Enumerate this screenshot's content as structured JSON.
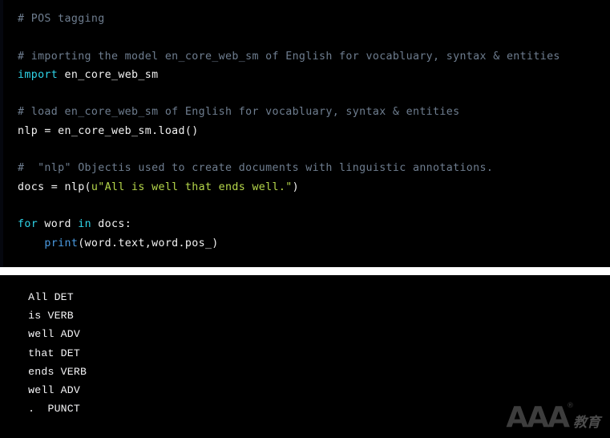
{
  "theme": {
    "editor_background": "#000000",
    "console_background": "#000000",
    "page_background": "#ffffff",
    "comment_color": "#6e7d8f",
    "keyword_color": "#2fd4e8",
    "plain_color": "#f2f2f2",
    "string_color": "#b5d64a",
    "function_color": "#4a9ae0",
    "console_text_color": "#f4f4f6",
    "watermark_color": "#707070"
  },
  "editor": {
    "name": "python-code-editor",
    "lines": [
      {
        "type": "comment",
        "text": "# POS tagging"
      },
      {
        "type": "blank",
        "text": ""
      },
      {
        "type": "comment",
        "text": "# importing the model en_core_web_sm of English for vocabluary, syntax & entities"
      },
      {
        "type": "code",
        "segments": [
          {
            "style": "kw",
            "text": "import"
          },
          {
            "style": "plain",
            "text": " en_core_web_sm"
          }
        ]
      },
      {
        "type": "blank",
        "text": ""
      },
      {
        "type": "comment",
        "text": "# load en_core_web_sm of English for vocabluary, syntax & entities"
      },
      {
        "type": "code",
        "segments": [
          {
            "style": "plain",
            "text": "nlp = en_core_web_sm.load()"
          }
        ]
      },
      {
        "type": "blank",
        "text": ""
      },
      {
        "type": "comment",
        "text": "#  \"nlp\" Objectis used to create documents with linguistic annotations."
      },
      {
        "type": "code",
        "segments": [
          {
            "style": "plain",
            "text": "docs = nlp("
          },
          {
            "style": "str",
            "text": "u\"All is well that ends well.\""
          },
          {
            "style": "plain",
            "text": ")"
          }
        ]
      },
      {
        "type": "blank",
        "text": ""
      },
      {
        "type": "code",
        "segments": [
          {
            "style": "kw",
            "text": "for"
          },
          {
            "style": "plain",
            "text": " word "
          },
          {
            "style": "kw",
            "text": "in"
          },
          {
            "style": "plain",
            "text": " docs:"
          }
        ]
      },
      {
        "type": "code",
        "segments": [
          {
            "style": "plain",
            "text": "    "
          },
          {
            "style": "fn",
            "text": "print"
          },
          {
            "style": "plain",
            "text": "(word.text,word.pos_)"
          }
        ]
      }
    ]
  },
  "console": {
    "name": "program-output",
    "lines": [
      " All DET",
      " is VERB",
      " well ADV",
      " that DET",
      " ends VERB",
      " well ADV",
      " .  PUNCT"
    ]
  },
  "watermark": {
    "brand": "AAA",
    "registered": "®",
    "subtitle": "教育"
  }
}
